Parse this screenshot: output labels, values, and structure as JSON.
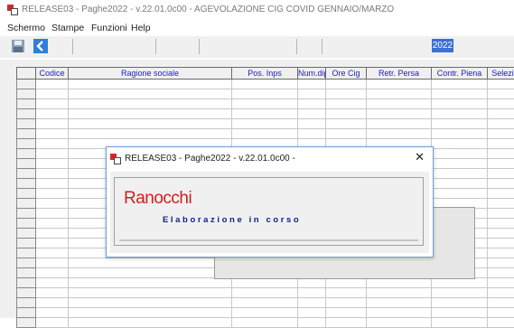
{
  "window": {
    "title": "RELEASE03 - Paghe2022 - v.22.01.0c00 - AGEVOLAZIONE CIG COVID GENNAIO/MARZO"
  },
  "menu": {
    "items": [
      "Schermo",
      "Stampe",
      "Funzioni",
      "Help"
    ]
  },
  "toolbar": {
    "year": "2022",
    "save_icon": "floppy-disk-icon",
    "back_icon": "arrow-left-icon",
    "accent": "#3d6fd6"
  },
  "grid": {
    "columns": [
      "Codice",
      "Ragione sociale",
      "Pos. Inps",
      "Num.dip",
      "Ore Cig",
      "Retr. Persa",
      "Contr. Piena",
      "Selezio"
    ],
    "header_color": "#1b1bc4"
  },
  "dialog": {
    "title": "RELEASE03 - Paghe2022 - v.22.01.0c00 -",
    "close_label": "✕",
    "brand": "Ranocchi",
    "brand_color": "#cf1f1f",
    "status": "Elaborazione in corso",
    "status_color": "#0b1f8a"
  }
}
